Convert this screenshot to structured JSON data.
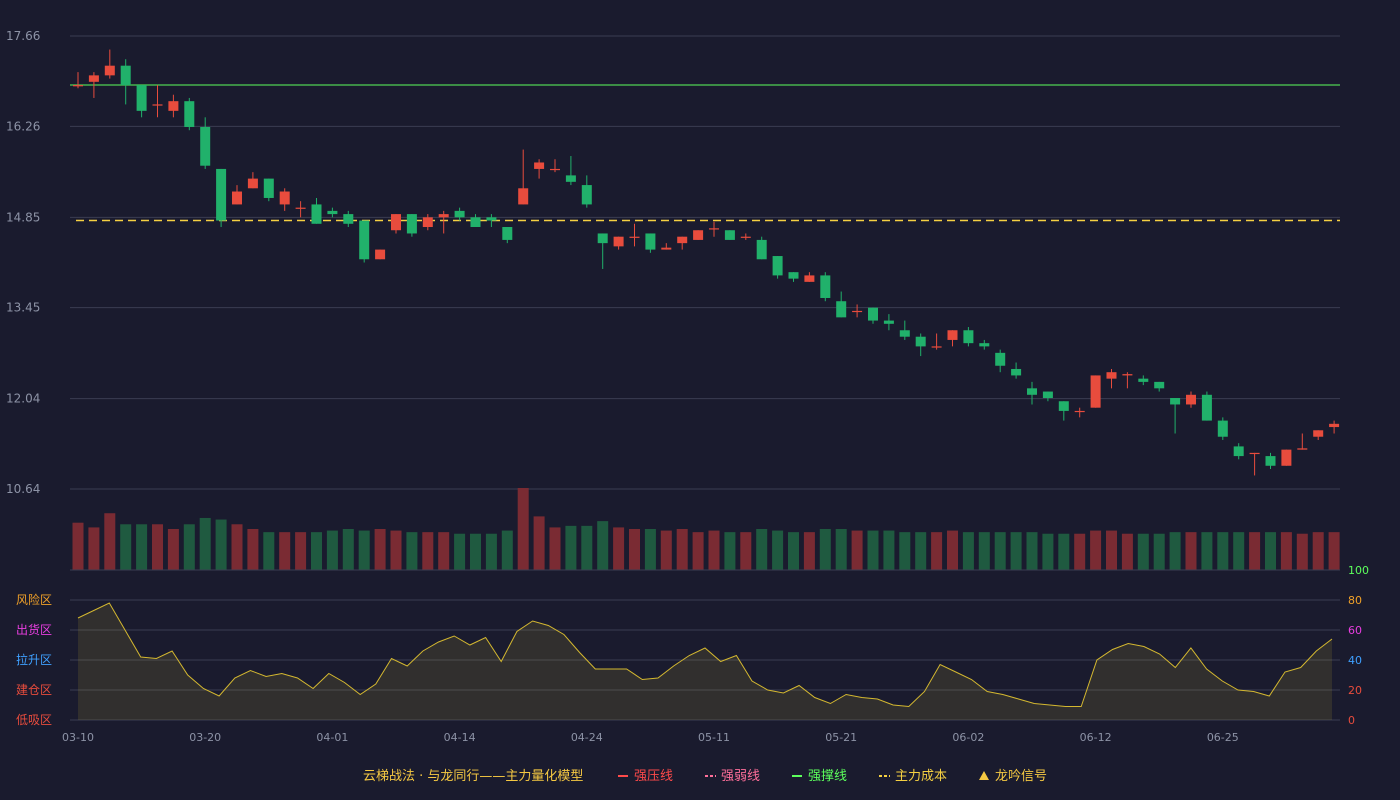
{
  "chart_data": {
    "type": "candlestick",
    "title": "云梯战法 · 与龙同行——主力量化模型",
    "price_axis": {
      "ticks": [
        "17.66",
        "16.26",
        "14.85",
        "13.45",
        "12.04",
        "10.64"
      ],
      "ylim": [
        10.64,
        17.66
      ]
    },
    "dates": [
      "03-10",
      "03-20",
      "04-01",
      "04-14",
      "04-24",
      "05-11",
      "05-21",
      "06-02",
      "06-12",
      "06-25"
    ],
    "date_positions": [
      0,
      8,
      16,
      24,
      32,
      40,
      48,
      56,
      64,
      72
    ],
    "levels": {
      "strong_support": 16.9,
      "main_cost": 14.8
    },
    "candles": [
      [
        16.88,
        16.9,
        17.1,
        16.85
      ],
      [
        16.95,
        17.05,
        17.1,
        16.7
      ],
      [
        17.05,
        17.2,
        17.45,
        17.0
      ],
      [
        17.2,
        16.9,
        17.3,
        16.6
      ],
      [
        16.9,
        16.5,
        16.9,
        16.4
      ],
      [
        16.6,
        16.6,
        16.9,
        16.4
      ],
      [
        16.5,
        16.65,
        16.75,
        16.4
      ],
      [
        16.65,
        16.25,
        16.7,
        16.2
      ],
      [
        16.25,
        15.65,
        16.4,
        15.6
      ],
      [
        15.6,
        14.8,
        15.6,
        14.7
      ],
      [
        15.05,
        15.25,
        15.35,
        15.05
      ],
      [
        15.3,
        15.45,
        15.55,
        15.3
      ],
      [
        15.45,
        15.15,
        15.45,
        15.1
      ],
      [
        15.05,
        15.25,
        15.3,
        14.95
      ],
      [
        15.0,
        15.0,
        15.1,
        14.85
      ],
      [
        15.05,
        14.75,
        15.15,
        14.75
      ],
      [
        14.95,
        14.9,
        15.0,
        14.85
      ],
      [
        14.9,
        14.75,
        14.95,
        14.7
      ],
      [
        14.8,
        14.2,
        14.8,
        14.15
      ],
      [
        14.2,
        14.35,
        14.35,
        14.2
      ],
      [
        14.65,
        14.9,
        14.9,
        14.6
      ],
      [
        14.9,
        14.6,
        14.9,
        14.55
      ],
      [
        14.7,
        14.85,
        14.9,
        14.65
      ],
      [
        14.85,
        14.9,
        14.95,
        14.6
      ],
      [
        14.95,
        14.85,
        15.0,
        14.8
      ],
      [
        14.85,
        14.7,
        14.9,
        14.7
      ],
      [
        14.85,
        14.8,
        14.9,
        14.7
      ],
      [
        14.7,
        14.5,
        14.7,
        14.45
      ],
      [
        15.05,
        15.3,
        15.9,
        15.05
      ],
      [
        15.6,
        15.7,
        15.75,
        15.45
      ],
      [
        15.6,
        15.6,
        15.75,
        15.55
      ],
      [
        15.5,
        15.4,
        15.8,
        15.35
      ],
      [
        15.35,
        15.05,
        15.5,
        15.0
      ],
      [
        14.6,
        14.45,
        14.6,
        14.05
      ],
      [
        14.4,
        14.55,
        14.55,
        14.35
      ],
      [
        14.55,
        14.55,
        14.75,
        14.4
      ],
      [
        14.6,
        14.35,
        14.6,
        14.3
      ],
      [
        14.35,
        14.38,
        14.45,
        14.35
      ],
      [
        14.45,
        14.55,
        14.55,
        14.35
      ],
      [
        14.5,
        14.65,
        14.65,
        14.5
      ],
      [
        14.68,
        14.68,
        14.78,
        14.55
      ],
      [
        14.65,
        14.5,
        14.65,
        14.5
      ],
      [
        14.55,
        14.55,
        14.6,
        14.5
      ],
      [
        14.5,
        14.2,
        14.55,
        14.2
      ],
      [
        14.25,
        13.95,
        14.25,
        13.9
      ],
      [
        14.0,
        13.9,
        14.0,
        13.85
      ],
      [
        13.85,
        13.95,
        14.0,
        13.85
      ],
      [
        13.95,
        13.6,
        14.0,
        13.55
      ],
      [
        13.55,
        13.3,
        13.7,
        13.3
      ],
      [
        13.4,
        13.4,
        13.5,
        13.3
      ],
      [
        13.45,
        13.25,
        13.45,
        13.2
      ],
      [
        13.25,
        13.2,
        13.35,
        13.1
      ],
      [
        13.1,
        13.0,
        13.25,
        12.95
      ],
      [
        13.0,
        12.85,
        13.05,
        12.7
      ],
      [
        12.85,
        12.85,
        13.05,
        12.8
      ],
      [
        12.95,
        13.1,
        13.1,
        12.85
      ],
      [
        13.1,
        12.9,
        13.15,
        12.85
      ],
      [
        12.9,
        12.85,
        12.95,
        12.8
      ],
      [
        12.75,
        12.55,
        12.8,
        12.45
      ],
      [
        12.5,
        12.4,
        12.6,
        12.35
      ],
      [
        12.2,
        12.1,
        12.3,
        11.95
      ],
      [
        12.15,
        12.05,
        12.15,
        12.0
      ],
      [
        12.0,
        11.85,
        12.0,
        11.7
      ],
      [
        11.85,
        11.85,
        11.9,
        11.75
      ],
      [
        11.9,
        12.4,
        12.4,
        11.9
      ],
      [
        12.35,
        12.45,
        12.5,
        12.2
      ],
      [
        12.4,
        12.42,
        12.45,
        12.2
      ],
      [
        12.35,
        12.3,
        12.4,
        12.25
      ],
      [
        12.3,
        12.2,
        12.3,
        12.15
      ],
      [
        12.05,
        11.95,
        12.05,
        11.5
      ],
      [
        11.95,
        12.1,
        12.15,
        11.9
      ],
      [
        12.1,
        11.7,
        12.15,
        11.7
      ],
      [
        11.7,
        11.45,
        11.75,
        11.4
      ],
      [
        11.3,
        11.15,
        11.35,
        11.1
      ],
      [
        11.2,
        11.2,
        11.2,
        10.85
      ],
      [
        11.15,
        11.0,
        11.2,
        10.95
      ],
      [
        11.0,
        11.25,
        11.25,
        11.0
      ],
      [
        11.25,
        11.27,
        11.5,
        11.25
      ],
      [
        11.45,
        11.55,
        11.55,
        11.4
      ],
      [
        11.6,
        11.65,
        11.7,
        11.5
      ]
    ],
    "volume": [
      30,
      27,
      36,
      29,
      29,
      29,
      26,
      29,
      33,
      32,
      29,
      26,
      24,
      24,
      24,
      24,
      25,
      26,
      25,
      26,
      25,
      24,
      24,
      24,
      23,
      23,
      23,
      25,
      52,
      34,
      27,
      28,
      28,
      31,
      27,
      26,
      26,
      25,
      26,
      24,
      25,
      24,
      24,
      26,
      25,
      24,
      24,
      26,
      26,
      25,
      25,
      25,
      24,
      24,
      24,
      25,
      24,
      24,
      24,
      24,
      24,
      23,
      23,
      23,
      25,
      25,
      23,
      23,
      23,
      24,
      24,
      24,
      24,
      24,
      24,
      24,
      24,
      23,
      24,
      24
    ],
    "oscillator": {
      "values": [
        68,
        73,
        78,
        60,
        42,
        41,
        46,
        30,
        21,
        16,
        28,
        33,
        29,
        31,
        28,
        21,
        31,
        25,
        17,
        24,
        41,
        36,
        46,
        52,
        56,
        50,
        55,
        39,
        59,
        66,
        63,
        57,
        45,
        34,
        34,
        34,
        27,
        28,
        36,
        43,
        48,
        39,
        43,
        26,
        20,
        18,
        23,
        15,
        11,
        17,
        15,
        14,
        10,
        9,
        19,
        37,
        32,
        27,
        19,
        17,
        14,
        11,
        10,
        9,
        9,
        40,
        47,
        51,
        49,
        44,
        35,
        48,
        34,
        26,
        20,
        19,
        16,
        32,
        35,
        46,
        54
      ],
      "ylim": [
        0,
        100
      ],
      "ticks": [
        "100",
        "80",
        "60",
        "40",
        "20",
        "0"
      ],
      "zones": [
        "风险区",
        "出货区",
        "拉升区",
        "建仓区",
        "低吸区"
      ],
      "zone_colors": [
        "#f0a028",
        "#e83ee0",
        "#3fa0ff",
        "#e84c3d",
        "#e84c3d"
      ]
    },
    "legend": [
      {
        "label": "云梯战法 · 与龙同行——主力量化模型",
        "color": "#f5c842",
        "marker": "none"
      },
      {
        "label": "强压线",
        "color": "#ff4a4a",
        "marker": "line"
      },
      {
        "label": "强弱线",
        "color": "#ff6f9a",
        "marker": "dash"
      },
      {
        "label": "强撑线",
        "color": "#5cff5c",
        "marker": "line"
      },
      {
        "label": "主力成本",
        "color": "#f5d042",
        "marker": "dash"
      },
      {
        "label": "龙吟信号",
        "color": "#f5c842",
        "marker": "triangle"
      }
    ],
    "colors": {
      "up": "#e84c3d",
      "down": "#21b16b",
      "up_vol": "#7a2b33",
      "down_vol": "#1f5a40",
      "support_line": "#5cff5c",
      "cost_line": "#f5d042",
      "osc_line": "#d4b830"
    }
  }
}
